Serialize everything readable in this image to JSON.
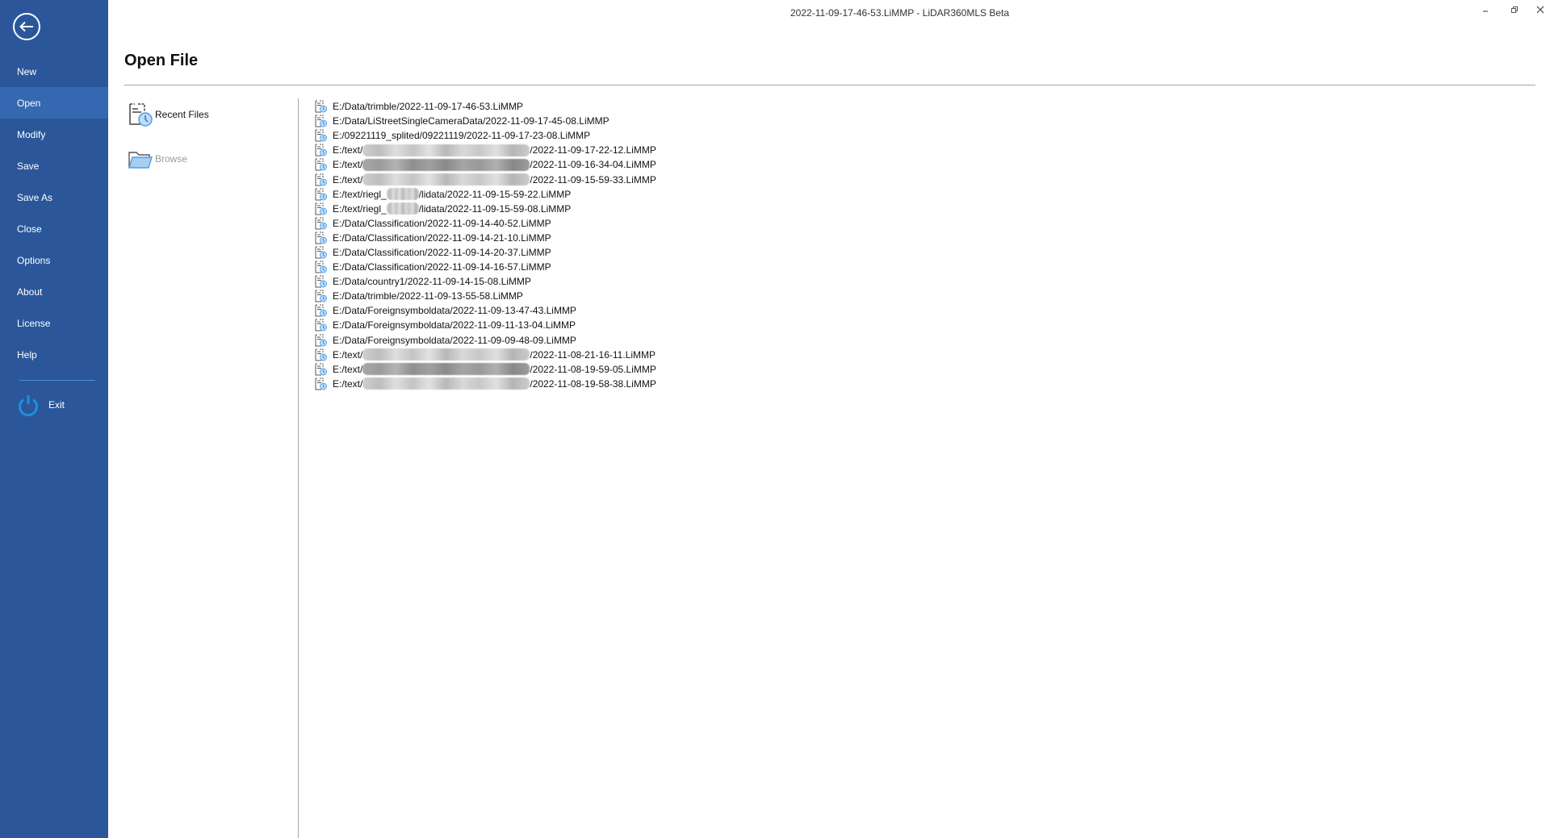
{
  "window": {
    "title": "2022-11-09-17-46-53.LiMMP - LiDAR360MLS Beta",
    "controls": [
      "minimize",
      "restore",
      "close"
    ]
  },
  "sidebar": {
    "back_icon": "back-arrow-icon",
    "items": [
      {
        "label": "New",
        "active": false
      },
      {
        "label": "Open",
        "active": true
      },
      {
        "label": "Modify",
        "active": false
      },
      {
        "label": "Save",
        "active": false
      },
      {
        "label": "Save As",
        "active": false
      },
      {
        "label": "Close",
        "active": false
      },
      {
        "label": "Options",
        "active": false
      },
      {
        "label": "About",
        "active": false
      },
      {
        "label": "License",
        "active": false
      },
      {
        "label": "Help",
        "active": false
      }
    ],
    "exit": {
      "label": "Exit",
      "icon": "power-icon"
    }
  },
  "main": {
    "title": "Open File",
    "sources": [
      {
        "label": "Recent Files",
        "icon": "recent-files-icon",
        "enabled": true
      },
      {
        "label": "Browse",
        "icon": "folder-icon",
        "enabled": false
      }
    ],
    "colors": {
      "sidebar": "#2b579a",
      "sidebar_active": "#3568b0",
      "accent_icon": "#4a9fe8"
    },
    "recent_files": [
      {
        "prefix": "E:/Data/trimble/2022-11-09-17-46-53.LiMMP",
        "redacted": null,
        "suffix": ""
      },
      {
        "prefix": "E:/Data/LiStreetSingleCameraData/2022-11-09-17-45-08.LiMMP",
        "redacted": null,
        "suffix": ""
      },
      {
        "prefix": "E:/09221119_splited/09221119/2022-11-09-17-23-08.LiMMP",
        "redacted": null,
        "suffix": ""
      },
      {
        "prefix": "E:/text/",
        "redacted": "long-light",
        "suffix": "/2022-11-09-17-22-12.LiMMP"
      },
      {
        "prefix": "E:/text/",
        "redacted": "long-dark",
        "suffix": "/2022-11-09-16-34-04.LiMMP"
      },
      {
        "prefix": "E:/text/",
        "redacted": "long-light",
        "suffix": "/2022-11-09-15-59-33.LiMMP"
      },
      {
        "prefix": "E:/text/riegl_",
        "redacted": "short",
        "suffix": "/lidata/2022-11-09-15-59-22.LiMMP"
      },
      {
        "prefix": "E:/text/riegl_",
        "redacted": "short",
        "suffix": "/lidata/2022-11-09-15-59-08.LiMMP"
      },
      {
        "prefix": "E:/Data/Classification/2022-11-09-14-40-52.LiMMP",
        "redacted": null,
        "suffix": ""
      },
      {
        "prefix": "E:/Data/Classification/2022-11-09-14-21-10.LiMMP",
        "redacted": null,
        "suffix": ""
      },
      {
        "prefix": "E:/Data/Classification/2022-11-09-14-20-37.LiMMP",
        "redacted": null,
        "suffix": ""
      },
      {
        "prefix": "E:/Data/Classification/2022-11-09-14-16-57.LiMMP",
        "redacted": null,
        "suffix": ""
      },
      {
        "prefix": "E:/Data/country1/2022-11-09-14-15-08.LiMMP",
        "redacted": null,
        "suffix": ""
      },
      {
        "prefix": "E:/Data/trimble/2022-11-09-13-55-58.LiMMP",
        "redacted": null,
        "suffix": ""
      },
      {
        "prefix": "E:/Data/Foreignsymboldata/2022-11-09-13-47-43.LiMMP",
        "redacted": null,
        "suffix": ""
      },
      {
        "prefix": "E:/Data/Foreignsymboldata/2022-11-09-11-13-04.LiMMP",
        "redacted": null,
        "suffix": ""
      },
      {
        "prefix": "E:/Data/Foreignsymboldata/2022-11-09-09-48-09.LiMMP",
        "redacted": null,
        "suffix": ""
      },
      {
        "prefix": "E:/text/",
        "redacted": "long-light",
        "suffix": "/2022-11-08-21-16-11.LiMMP"
      },
      {
        "prefix": "E:/text/",
        "redacted": "long-dark",
        "suffix": "/2022-11-08-19-59-05.LiMMP"
      },
      {
        "prefix": "E:/text/",
        "redacted": "long-light",
        "suffix": "/2022-11-08-19-58-38.LiMMP"
      }
    ]
  }
}
